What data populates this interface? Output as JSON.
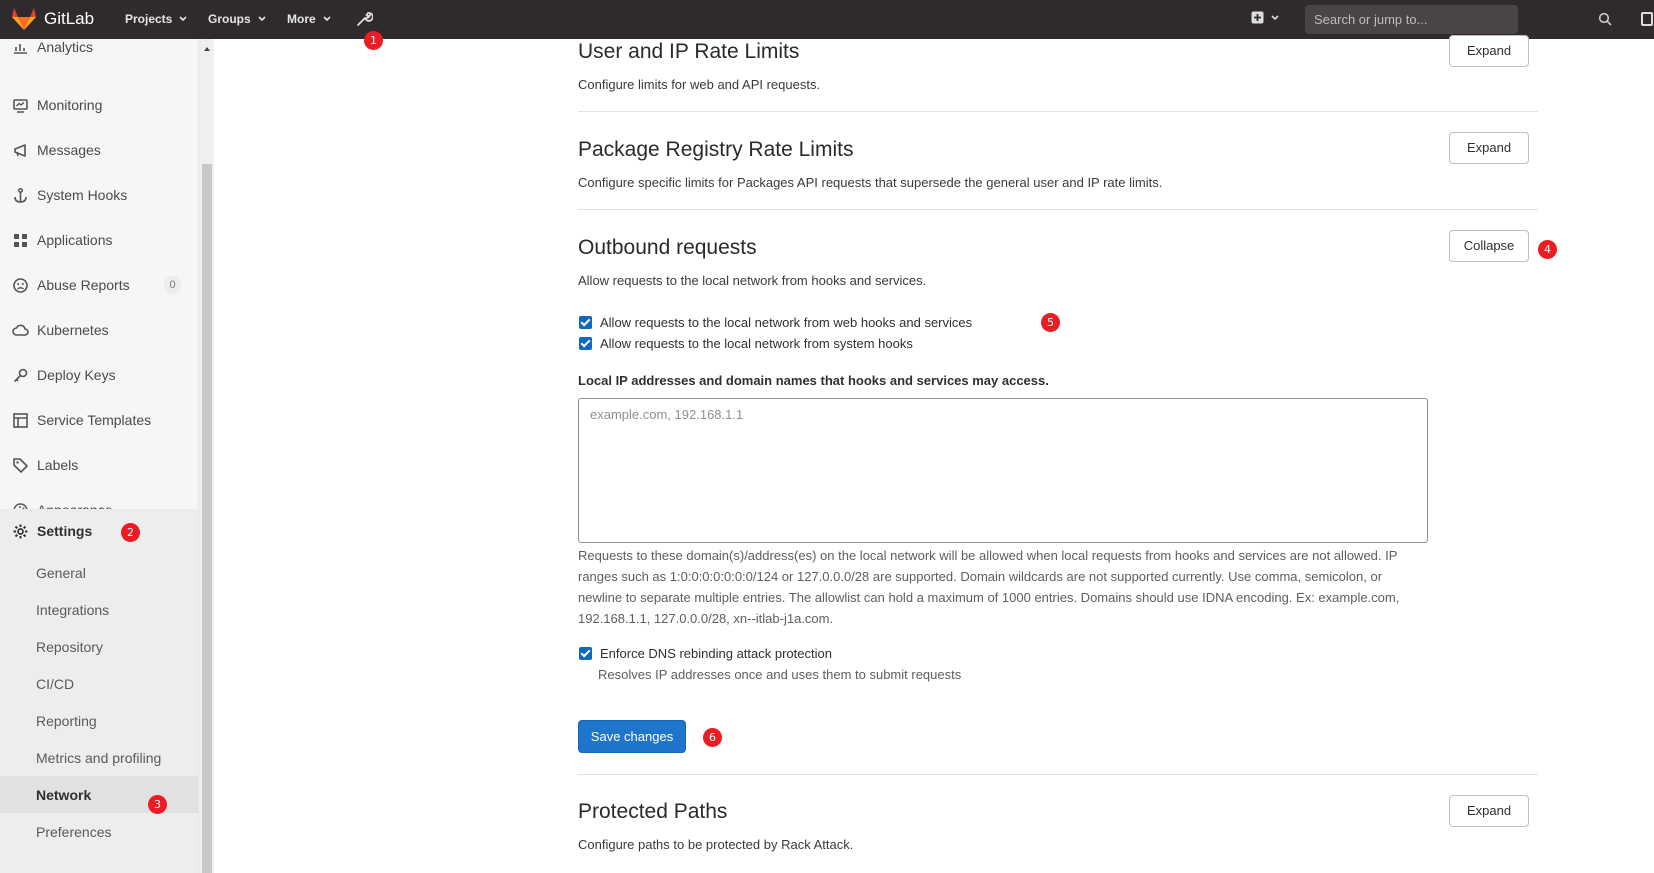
{
  "navbar": {
    "brand": "GitLab",
    "items": [
      {
        "label": "Projects"
      },
      {
        "label": "Groups"
      },
      {
        "label": "More"
      }
    ],
    "search_placeholder": "Search or jump to..."
  },
  "sidebar": {
    "partial_item": "Analytics",
    "items": [
      {
        "label": "Monitoring",
        "icon": "monitor-icon"
      },
      {
        "label": "Messages",
        "icon": "megaphone-icon"
      },
      {
        "label": "System Hooks",
        "icon": "anchor-icon"
      },
      {
        "label": "Applications",
        "icon": "grid-icon"
      },
      {
        "label": "Abuse Reports",
        "icon": "abuse-icon",
        "count": "0"
      },
      {
        "label": "Kubernetes",
        "icon": "cloud-icon"
      },
      {
        "label": "Deploy Keys",
        "icon": "key-icon"
      },
      {
        "label": "Service Templates",
        "icon": "template-icon"
      },
      {
        "label": "Labels",
        "icon": "tag-icon"
      },
      {
        "label": "Appearance",
        "icon": "palette-icon"
      }
    ],
    "settings": {
      "label": "Settings",
      "sub_items": [
        "General",
        "Integrations",
        "Repository",
        "CI/CD",
        "Reporting",
        "Metrics and profiling",
        "Network",
        "Preferences"
      ],
      "active": "Network"
    }
  },
  "markers": [
    "1",
    "2",
    "3",
    "4",
    "5",
    "6"
  ],
  "main": {
    "sections": [
      {
        "title": "User and IP Rate Limits",
        "desc": "Configure limits for web and API requests.",
        "button": "Expand"
      },
      {
        "title": "Package Registry Rate Limits",
        "desc": "Configure specific limits for Packages API requests that supersede the general user and IP rate limits.",
        "button": "Expand"
      },
      {
        "title": "Outbound requests",
        "desc": "Allow requests to the local network from hooks and services.",
        "button": "Collapse"
      },
      {
        "title": "Protected Paths",
        "desc": "Configure paths to be protected by Rack Attack.",
        "button": "Expand"
      }
    ],
    "outbound": {
      "check1": "Allow requests to the local network from web hooks and services",
      "check2": "Allow requests to the local network from system hooks",
      "field_label": "Local IP addresses and domain names that hooks and services may access.",
      "field_placeholder": "example.com, 192.168.1.1",
      "help": "Requests to these domain(s)/address(es) on the local network will be allowed when local requests from hooks and services are not allowed. IP ranges such as 1:0:0:0:0:0:0:0/124 or 127.0.0.0/28 are supported. Domain wildcards are not supported currently. Use comma, semicolon, or newline to separate multiple entries. The allowlist can hold a maximum of 1000 entries. Domains should use IDNA encoding. Ex: example.com, 192.168.1.1, 127.0.0.0/28, xn--itlab-j1a.com.",
      "dns_check": "Enforce DNS rebinding attack protection",
      "dns_help": "Resolves IP addresses once and uses them to submit requests",
      "save": "Save changes"
    }
  },
  "colors": {
    "navbar": "#2f2a2d",
    "primary": "#1f75cb",
    "marker": "#ec1c24"
  }
}
